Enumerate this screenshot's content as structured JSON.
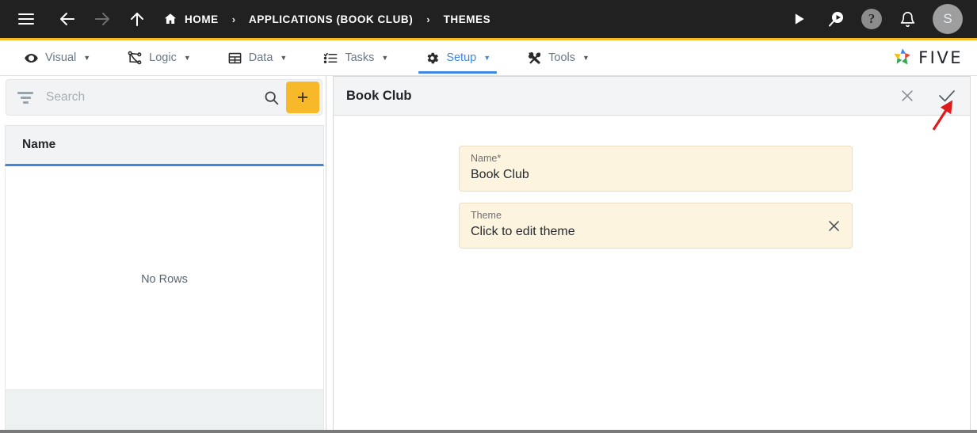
{
  "topbar": {
    "menu_icon": "hamburger-icon",
    "back_icon": "arrow-left-icon",
    "forward_icon": "arrow-right-icon",
    "up_icon": "arrow-up-icon",
    "breadcrumbs": [
      {
        "label": "HOME",
        "icon": "home-icon"
      },
      {
        "label": "APPLICATIONS (BOOK CLUB)",
        "icon": ""
      },
      {
        "label": "THEMES",
        "icon": ""
      }
    ],
    "separator": "›",
    "actions": [
      {
        "name": "run-button",
        "icon": "play-icon"
      },
      {
        "name": "search-run-button",
        "icon": "search-play-icon"
      },
      {
        "name": "help-button",
        "icon": "help-icon",
        "label": "?"
      },
      {
        "name": "notifications-button",
        "icon": "bell-icon"
      }
    ],
    "avatar_initial": "S"
  },
  "menubar": {
    "accent_top_color": "#f7b924",
    "active_color": "#3f87e0",
    "items": [
      {
        "label": "Visual",
        "icon": "eye-icon",
        "caret": "▼",
        "active": false
      },
      {
        "label": "Logic",
        "icon": "share-nodes-icon",
        "caret": "▼",
        "active": false
      },
      {
        "label": "Data",
        "icon": "table-icon",
        "caret": "▼",
        "active": false
      },
      {
        "label": "Tasks",
        "icon": "checklist-icon",
        "caret": "▼",
        "active": false
      },
      {
        "label": "Setup",
        "icon": "gear-icon",
        "caret": "▼",
        "active": true
      },
      {
        "label": "Tools",
        "icon": "tools-icon",
        "caret": "▼",
        "active": false
      }
    ],
    "brand": "FIVE"
  },
  "left_panel": {
    "filter_icon": "filter-icon",
    "search": {
      "value": "",
      "placeholder": "Search"
    },
    "search_icon": "search-icon",
    "add_button_label": "+",
    "add_button_color": "#f7b929",
    "grid": {
      "columns": [
        "Name"
      ],
      "rows": [],
      "empty_message": "No Rows"
    }
  },
  "record": {
    "title": "Book Club",
    "close_label": "✕",
    "save_label": "✓",
    "fields": [
      {
        "label": "Name",
        "required": true,
        "required_mark": "*",
        "value": "Book Club",
        "has_clear": false
      },
      {
        "label": "Theme",
        "required": false,
        "required_mark": "",
        "value": "Click to edit theme",
        "has_clear": true,
        "clear_label": "✕"
      }
    ]
  },
  "annotation": {
    "arrow_color": "#e01b1b",
    "points_to": "save-check-button"
  }
}
